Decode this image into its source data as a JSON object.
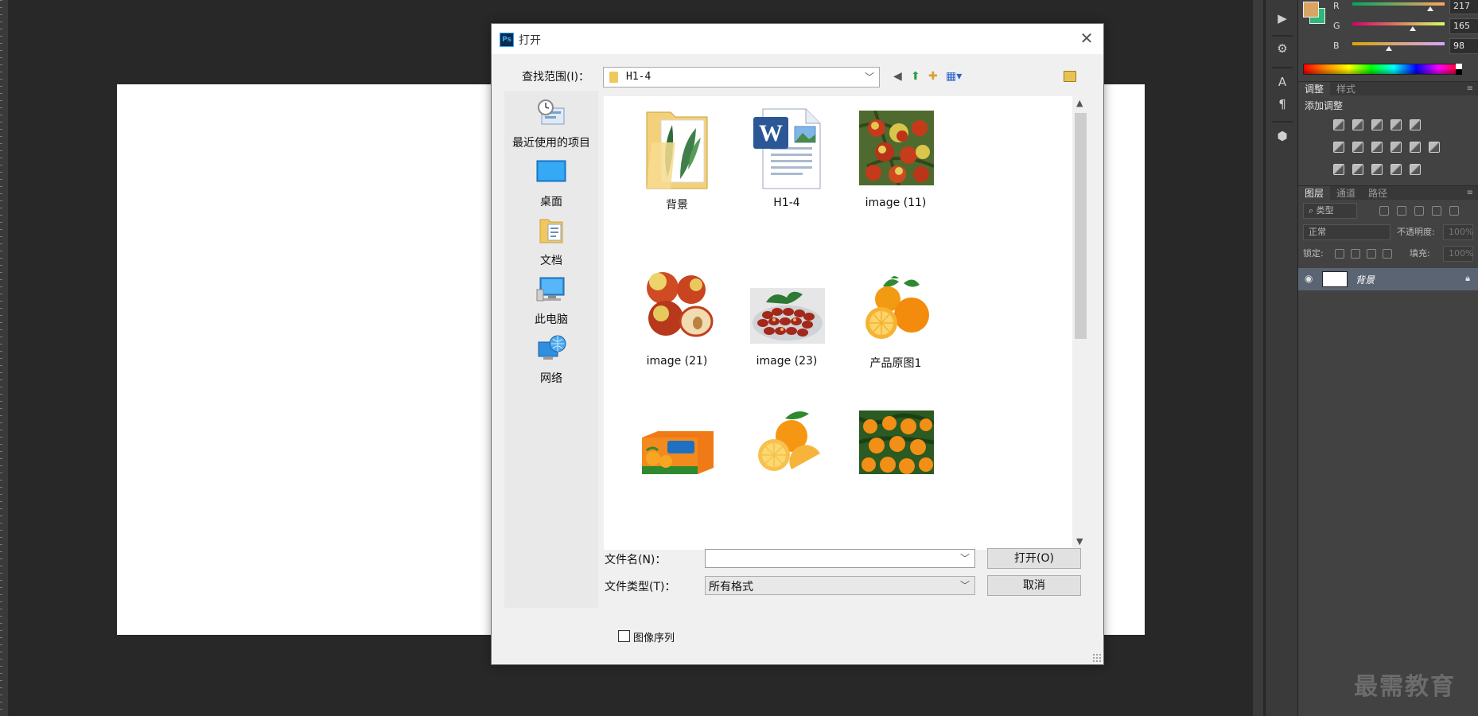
{
  "dialog": {
    "title": "打开",
    "app_logo": "Ps",
    "look_in_label": "查找范围(I)：",
    "look_in_value": "H1-4",
    "places": [
      {
        "label": "最近使用的项目",
        "icon": "recent-items-icon"
      },
      {
        "label": "桌面",
        "icon": "desktop-icon"
      },
      {
        "label": "文档",
        "icon": "documents-icon"
      },
      {
        "label": "此电脑",
        "icon": "computer-icon"
      },
      {
        "label": "网络",
        "icon": "network-icon"
      }
    ],
    "files": [
      {
        "name": "背景",
        "type": "folder"
      },
      {
        "name": "H1-4",
        "type": "word-document"
      },
      {
        "name": "image (11)",
        "type": "image"
      },
      {
        "name": "image (21)",
        "type": "image"
      },
      {
        "name": "image (23)",
        "type": "image"
      },
      {
        "name": "产品原图1",
        "type": "image"
      },
      {
        "name": "",
        "type": "image"
      },
      {
        "name": "",
        "type": "image"
      },
      {
        "name": "",
        "type": "image"
      }
    ],
    "filename_label": "文件名(N)：",
    "filename_value": "",
    "filetype_label": "文件类型(T)：",
    "filetype_value": "所有格式",
    "open_button": "打开(O)",
    "cancel_button": "取消",
    "image_sequence_label": "图像序列",
    "image_sequence_checked": false
  },
  "photoshop": {
    "color_panel": {
      "foreground": "#d9a562",
      "background": "#2db77a",
      "channels": [
        {
          "label": "R",
          "value": "217"
        },
        {
          "label": "G",
          "value": "165"
        },
        {
          "label": "B",
          "value": "98"
        }
      ]
    },
    "adjust_tabs": [
      "调整",
      "样式"
    ],
    "adjust_title": "添加调整",
    "layers_tabs": [
      "图层",
      "通道",
      "路径"
    ],
    "layer_filter": "类型",
    "blend_mode": "正常",
    "opacity_label": "不透明度:",
    "opacity_value": "100%",
    "lock_label": "锁定:",
    "fill_label": "填充:",
    "fill_value": "100%",
    "layer_name": "背景"
  },
  "watermark": "最需教育"
}
